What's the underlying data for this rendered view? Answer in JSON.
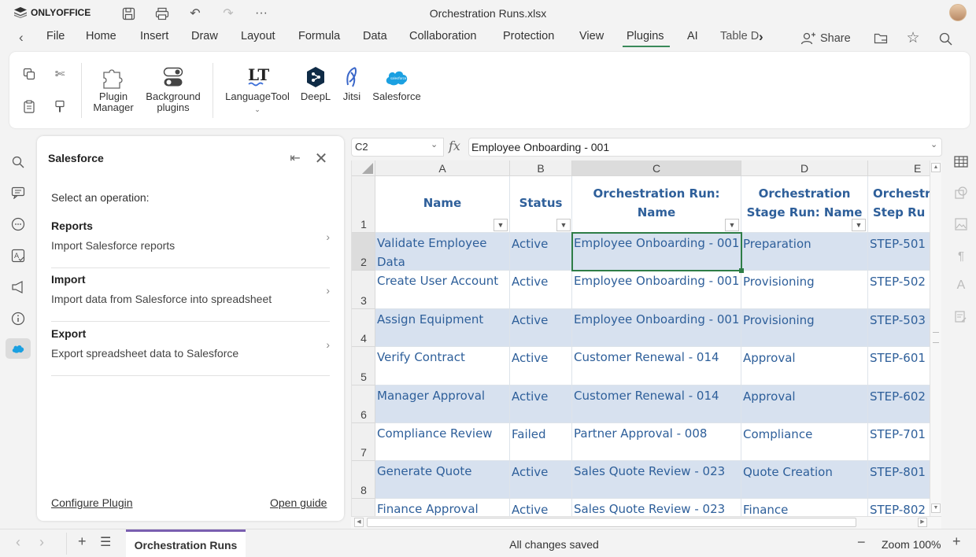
{
  "app": {
    "brand": "ONLYOFFICE",
    "doc_title": "Orchestration Runs.xlsx"
  },
  "menu": {
    "tabs": [
      "File",
      "Home",
      "Insert",
      "Draw",
      "Layout",
      "Formula",
      "Data",
      "Collaboration",
      "Protection",
      "View",
      "Plugins",
      "AI",
      "Table D"
    ],
    "active_tab": "Plugins",
    "share_label": "Share"
  },
  "ribbon": {
    "plugin_manager": "Plugin\nManager",
    "background_plugins": "Background\nplugins",
    "languagetool": "LanguageTool",
    "deepl": "DeepL",
    "jitsi": "Jitsi",
    "salesforce": "Salesforce"
  },
  "panel": {
    "title": "Salesforce",
    "select_label": "Select an operation:",
    "operations": [
      {
        "title": "Reports",
        "desc": "Import Salesforce reports"
      },
      {
        "title": "Import",
        "desc": "Import data from Salesforce into spreadsheet"
      },
      {
        "title": "Export",
        "desc": "Export spreadsheet data to Salesforce"
      }
    ],
    "configure_link": "Configure Plugin",
    "guide_link": "Open guide"
  },
  "formula_bar": {
    "cell_ref": "C2",
    "fx": "fx",
    "value": "Employee Onboarding - 001"
  },
  "grid": {
    "columns": [
      "A",
      "B",
      "C",
      "D",
      "E"
    ],
    "rows": [
      "1",
      "2",
      "3",
      "4",
      "5",
      "6",
      "7",
      "8"
    ],
    "headers": [
      "Name",
      "Status",
      "Orchestration Run: Name",
      "Orchestration Stage Run: Name",
      "Orchestr Step Ru"
    ],
    "data": [
      [
        "Validate Employee Data",
        "Active",
        "Employee Onboarding - 001",
        "Preparation",
        "STEP-501"
      ],
      [
        "Create User Account",
        "Active",
        "Employee Onboarding - 001",
        "Provisioning",
        "STEP-502"
      ],
      [
        "Assign Equipment",
        "Active",
        "Employee Onboarding - 001",
        "Provisioning",
        "STEP-503"
      ],
      [
        "Verify Contract",
        "Active",
        "Customer Renewal - 014",
        "Approval",
        "STEP-601"
      ],
      [
        "Manager Approval",
        "Active",
        "Customer Renewal - 014",
        "Approval",
        "STEP-602"
      ],
      [
        "Compliance Review",
        "Failed",
        "Partner Approval - 008",
        "Compliance",
        "STEP-701"
      ],
      [
        "Generate Quote",
        "Active",
        "Sales Quote Review - 023",
        "Quote Creation",
        "STEP-801"
      ],
      [
        "Finance Approval",
        "Active",
        "Sales Quote Review - 023",
        "Finance",
        "STEP-802"
      ]
    ],
    "selected_cell": "C2"
  },
  "status": {
    "sheet_name": "Orchestration Runs",
    "save_state": "All changes saved",
    "zoom": "Zoom 100%"
  },
  "colors": {
    "accent_green": "#2e7d46",
    "band_blue": "#d7e1ef",
    "text_blue": "#2e5f9a",
    "sheet_tab_purple": "#7a5fb0"
  }
}
